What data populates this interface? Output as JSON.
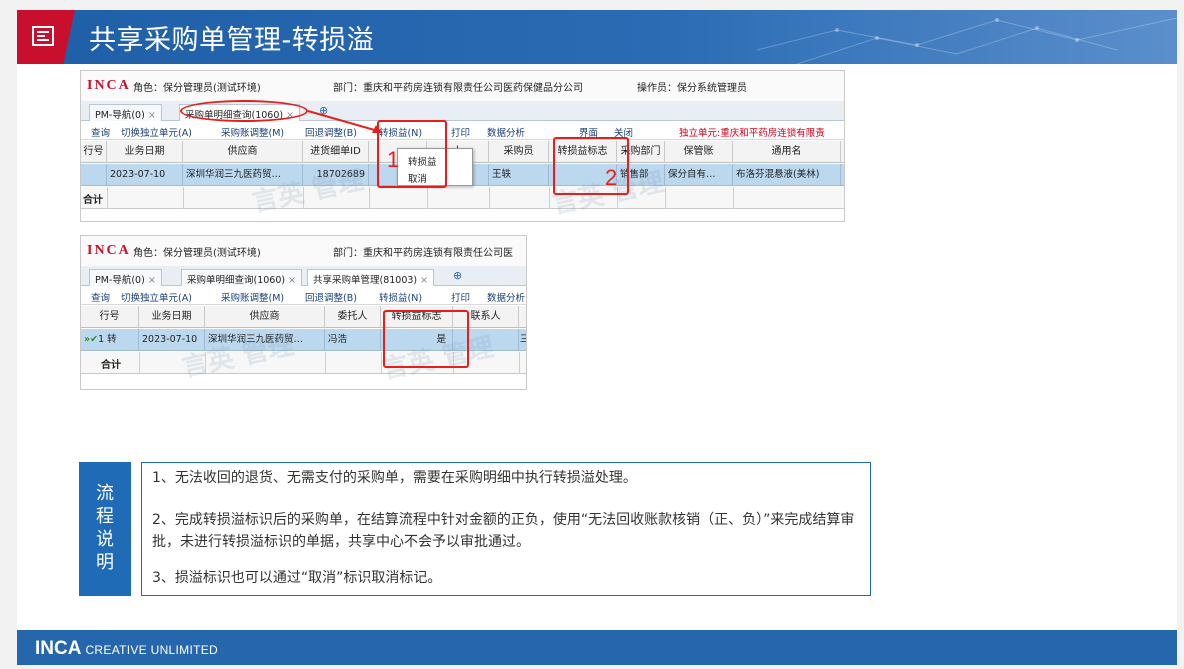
{
  "header": {
    "title": "共享采购单管理-转损溢"
  },
  "footer": {
    "brand": "INCA",
    "tagline": "CREATIVE UNLIMITED"
  },
  "shot1": {
    "logo": "INCA",
    "role": "角色：保分管理员(测试环境)",
    "dept": "部门：重庆和平药房连锁有限责任公司医药保健品分公司",
    "operator": "操作员：保分系统管理员",
    "tabs": [
      {
        "label": "PM-导航(0)",
        "close": "×"
      },
      {
        "label": "采购单明细查询(1060)",
        "close": "×"
      }
    ],
    "tab_plus": "⊕",
    "menu": [
      "查询",
      "切换独立单元(A)",
      "采购账调整(M)",
      "回退调整(B)",
      "转损益(N)",
      "打印",
      "数据分析",
      "界面",
      "关闭"
    ],
    "independent_unit": "独立单元:重庆和平药房连锁有限责",
    "columns": [
      "行号",
      "业务日期",
      "供应商",
      "进货细单ID",
      "",
      "人",
      "采购员",
      "转损益标志",
      "采购部门",
      "保管账",
      "通用名"
    ],
    "row": [
      "",
      "2023-07-10",
      "深圳华润三九医药贸…",
      "18702689",
      "",
      "",
      "王轶",
      "",
      "销售部",
      "保分自有…",
      "布洛芬混悬液(美林)"
    ],
    "total_label": "合计",
    "popup": [
      "转损益",
      "取消"
    ],
    "marker1": "1",
    "marker2": "2",
    "watermark": "言英 管理"
  },
  "shot2": {
    "logo": "INCA",
    "role": "角色：保分管理员(测试环境)",
    "dept": "部门：重庆和平药房连锁有限责任公司医",
    "tabs": [
      {
        "label": "PM-导航(0)",
        "close": "×"
      },
      {
        "label": "采购单明细查询(1060)",
        "close": "×"
      },
      {
        "label": "共享采购单管理(81003)",
        "close": "×"
      }
    ],
    "tab_plus": "⊕",
    "menu": [
      "查询",
      "切换独立单元(A)",
      "采购账调整(M)",
      "回退调整(B)",
      "转损益(N)",
      "打印",
      "数据分析"
    ],
    "columns": [
      "行号",
      "业务日期",
      "供应商",
      "委托人",
      "转损益标志",
      "联系人"
    ],
    "row": [
      "1 转",
      "2023-07-10",
      "深圳华润三九医药贸…",
      "冯浩",
      "是",
      "",
      "三"
    ],
    "row_marker": "»✔",
    "total_label": "合计",
    "watermark": "言英 管理"
  },
  "process": {
    "label_chars": [
      "流",
      "程",
      "说",
      "明"
    ],
    "lines": [
      "1、无法收回的退货、无需支付的采购单，需要在采购明细中执行转损溢处理。",
      "2、完成转损溢标识后的采购单，在结算流程中针对金额的正负，使用“无法回收账款核销（正、负）”来完成结算审批，未进行转损溢标识的单据，共享中心不会予以审批通过。",
      "3、损溢标识也可以通过“取消”标识取消标记。"
    ]
  },
  "colors": {
    "header_blue": "#1f5fa8",
    "accent_red": "#c8102e",
    "highlight_red": "#e3201c",
    "process_blue": "#1f6bb5",
    "row_selected": "#bcd8ef"
  }
}
